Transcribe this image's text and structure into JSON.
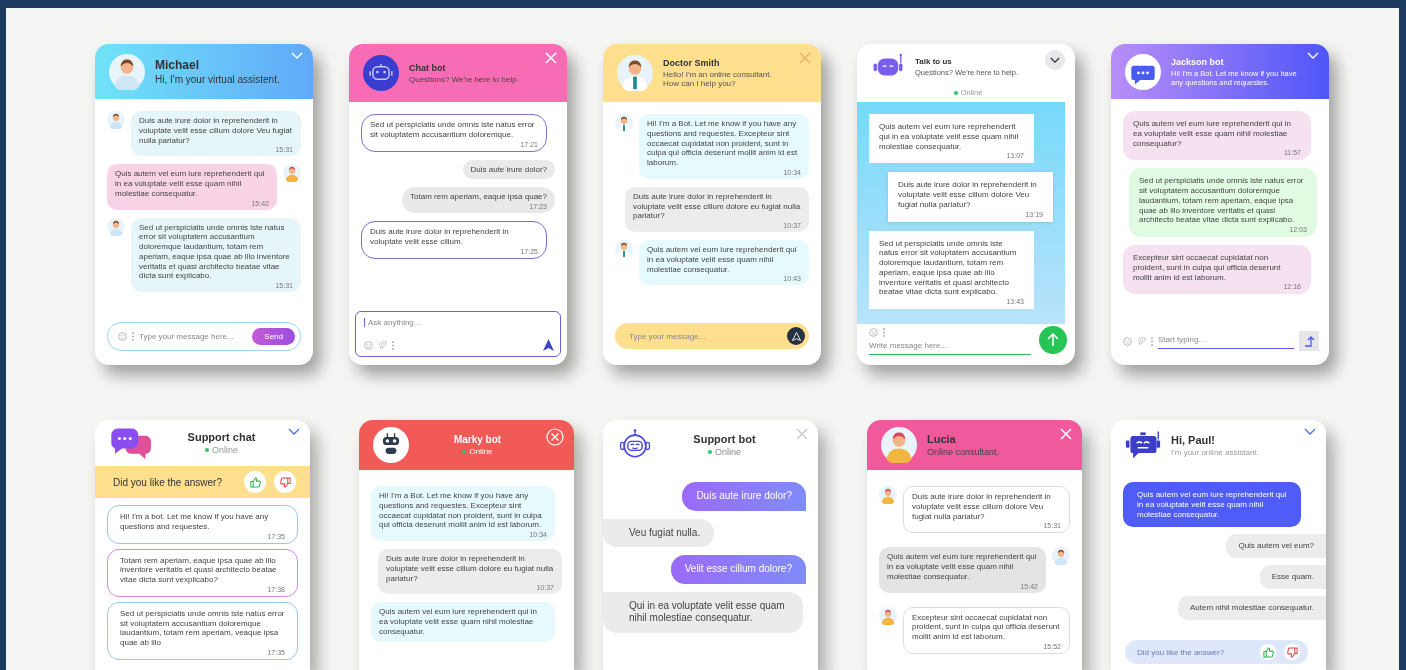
{
  "widgets": [
    {
      "header": {
        "title": "Michael",
        "subtitle": "Hi, I'm your virtual assistent."
      },
      "messages": [
        {
          "from_user": false,
          "text": "Duis aute irure dolor in reprehenderit in voluptate velit esse cillum dolore Veu fugiat nulla pariatur?",
          "time": "15:31"
        },
        {
          "from_user": true,
          "text": "Quis autem vel eum iure reprehenderit qui in ea voluptate velit esse quam nihil molestiae consequatur.",
          "time": "15:42"
        },
        {
          "from_user": false,
          "text": "Sed ut perspiciatis unde omnis iste natus error sit voluptatem accusantium doloremque laudantium, totam rem aperiam, eaque ipsa quae ab illo inventore veritatis et quasi architecto beatae vitae dicta sunt explicabo.",
          "time": "15:31"
        }
      ],
      "composer": {
        "placeholder": "Type your message here...",
        "send_label": "Send"
      }
    },
    {
      "header": {
        "title": "Chat bot",
        "subtitle": "Questions? We're here to help."
      },
      "messages": [
        {
          "from_user": false,
          "text": "Sed ut perspiciatis unde omnis iste natus error sit voluptatem accusantium doloremque.",
          "time": "17:21"
        },
        {
          "from_user": true,
          "text": "Duis aute irure dolor?"
        },
        {
          "from_user": true,
          "text": "Totam rem aperiam, eaque ipsa quae?",
          "time": "17:23"
        },
        {
          "from_user": false,
          "text": "Duis aute irure dolor in reprehenderit in voluptate velit esse cillum.",
          "time": "17:25"
        }
      ],
      "composer": {
        "placeholder": "Ask anything..."
      }
    },
    {
      "header": {
        "title": "Doctor Smith",
        "subtitle": "Hello! I'm an online consultant. How can I help you?"
      },
      "messages": [
        {
          "from_user": false,
          "text": "Hi! I'm a Bot. Let me know if you have any questions and requestes. Excepteur sint occaecat cupidatat non proident, sunt in culpa qui officia deserunt mollit anim id est laborum.",
          "time": "10:34"
        },
        {
          "from_user": true,
          "text": "Duis aute irure dolor in reprehenderit in voluptate velit esse cillum dolore eu fugiat nulla pariatur?",
          "time": "10:37"
        },
        {
          "from_user": false,
          "text": "Quis autem vel eum iure reprehenderit qui in ea voluptate velit esse quam nihil molestiae consequatur.",
          "time": "10:43"
        }
      ],
      "composer": {
        "placeholder": "Type your message..."
      }
    },
    {
      "header": {
        "title": "Talk to us",
        "subtitle": "Questions? We're here to help.",
        "status": "Online"
      },
      "messages": [
        {
          "from_user": false,
          "text": "Quis autem vel eum iure reprehenderit qui in ea voluptate velit esse quam nihil molestiae consequatur.",
          "time": "13:07"
        },
        {
          "from_user": true,
          "text": "Duis aute irure dolor in reprehenderit in voluptate velit esse cillum dolore Veu fugiat nulla pariatur?",
          "time": "13:19"
        },
        {
          "from_user": false,
          "text": "Sed ut perspiciatis unde omnis iste natus error sit voluptatem accusantium doloremque laudantium, totam rem aperiam, eaque ipsa quae ab illo inventore veritatis et quasi architecto beatae vitae dicta sunt explicabo.",
          "time": "13:43"
        }
      ],
      "composer": {
        "placeholder": "Write message here..."
      }
    },
    {
      "header": {
        "title": "Jackson bot",
        "subtitle": "Hi! I'm a Bot. Let me know if you have any questions and requestes."
      },
      "messages": [
        {
          "from_user": false,
          "text": "Quis autem vel eum iure reprehenderit qui in ea voluptate velit esse quam nihil molestiae consequatur?",
          "time": "11:57"
        },
        {
          "from_user": true,
          "text": "Sed ut perspiciatis unde omnis iste natus error sit voluptatem accusantium doloremque laudantium, totam rem aperiam, eaque ipsa quae ab illo inventore veritatis et quasi architecto beatae vitae dicta sunt explicabo.",
          "time": "12:03"
        },
        {
          "from_user": false,
          "text": "Excepteur sint occaecat cupidatat non proident, sunt in culpa qui officia deserunt mollit anim id est laborum.",
          "time": "12:16"
        }
      ],
      "composer": {
        "placeholder": "Start typing..."
      }
    },
    {
      "header": {
        "title": "Support chat",
        "status": "Online"
      },
      "feedback": {
        "question": "Did you like the answer?"
      },
      "messages": [
        {
          "from_user": false,
          "text": "Hi! I'm a bot. Let me know if you have any questions and requestes.",
          "time": "17:35"
        },
        {
          "from_user": true,
          "text": "Totam rem aperiam, eaque ipsa quae ab illo inventore veritatis et quasi architecto beatae vitae dicta sunt vexplicabo?",
          "time": "17:38"
        },
        {
          "from_user": false,
          "text": "Sed ut perspiciatis unde omnis iste natus error sit voluptatem accusantium doloremque laudantium, totam rem aperiam, veaque ipsa quae ab illo",
          "time": "17:35"
        }
      ]
    },
    {
      "header": {
        "title": "Marky bot",
        "status": "Online"
      },
      "messages": [
        {
          "from_user": false,
          "text": "Hi! I'm a Bot. Let me know if you have any questions and requestes. Excepteur sint occaecat cupidatat non proident, sunt in culpa qui officia deserunt mollit anim id est laborum.",
          "time": "10:34"
        },
        {
          "from_user": true,
          "text": "Duis aute irure dolor in reprehenderit in voluptate velit esse cillum dolore eu fugiat nulla pariatur?",
          "time": "10:37"
        },
        {
          "from_user": false,
          "text": "Quis autem vel eum iure reprehenderit qui in ea voluptate velit esse quam nihil molestiae consequatur."
        }
      ]
    },
    {
      "header": {
        "title": "Support bot",
        "status": "Online"
      },
      "messages": [
        {
          "from_user": true,
          "text": "Duis aute irure dolor?"
        },
        {
          "from_user": false,
          "text": "Veu fugiat nulla."
        },
        {
          "from_user": true,
          "text": "Velit esse cillum dolore?"
        },
        {
          "from_user": false,
          "text": "Qui in ea voluptate velit esse quam nihil molestiae consequatur."
        }
      ]
    },
    {
      "header": {
        "title": "Lucia",
        "subtitle": "Online consultant."
      },
      "messages": [
        {
          "from_user": false,
          "text": "Duis aute irure dolor in reprehenderit in voluptate velit esse cillum dolore Veu fugiat nulla pariatur?",
          "time": "15:31"
        },
        {
          "from_user": true,
          "text": "Quis autem vel eum iure reprehenderit qui in ea voluptate velit esse quam nihil molestiae consequatur.",
          "time": "15:42"
        },
        {
          "from_user": false,
          "text": "Excepteur sint occaecat cupidatat non proident, sunt in culpa qui officia deserunt mollit anim id est laborum.",
          "time": "15:52"
        }
      ]
    },
    {
      "header": {
        "title": "Hi, Paul!",
        "subtitle": "I'm your online assistant."
      },
      "messages": [
        {
          "from_user": false,
          "text": "Quis autem vel eum iure reprehenderit qui in ea voluptate velit esse quam nihil molestiae consequatur."
        },
        {
          "from_user": true,
          "text": "Quis autem vel eum?"
        },
        {
          "from_user": true,
          "text": "Esse quam."
        },
        {
          "from_user": true,
          "text": "Autem nihil molestiae consequatur."
        }
      ],
      "feedback": {
        "question": "Did you like the answer?"
      }
    }
  ]
}
